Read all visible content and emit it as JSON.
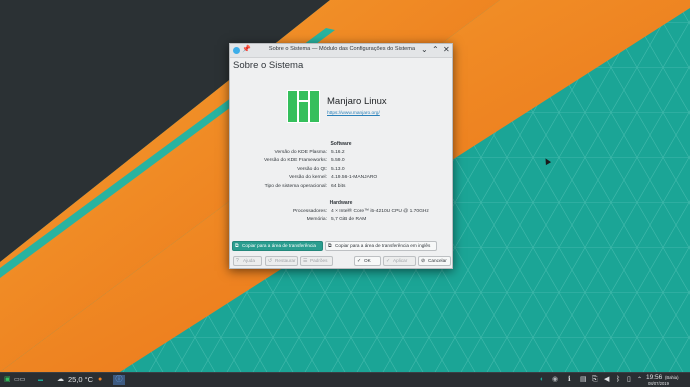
{
  "window": {
    "title": "Sobre o Sistema — Módulo das Configurações do Sistema",
    "heading": "Sobre o Sistema",
    "pin_icon": "pin-icon",
    "minimize_glyph": "⌄",
    "maximize_glyph": "⌃",
    "close_glyph": "✕"
  },
  "about": {
    "distro_name": "Manjaro Linux",
    "distro_url": "https://www.manjaro.org/",
    "software_heading": "Software",
    "software": [
      {
        "label": "Versão do KDE Plasma:",
        "value": "5.16.2"
      },
      {
        "label": "Versão do KDE Frameworks:",
        "value": "5.59.0"
      },
      {
        "label": "Versão do Qt:",
        "value": "5.13.0"
      },
      {
        "label": "Versão do kernel:",
        "value": "4.19.56-1-MANJARO"
      },
      {
        "label": "Tipo de sistema operacional:",
        "value": "64 bits"
      }
    ],
    "hardware_heading": "Hardware",
    "hardware": [
      {
        "label": "Processadores:",
        "value": "4 × Intel® Core™ i5-4210U CPU @ 1.70GHz"
      },
      {
        "label": "Memória:",
        "value": "5,7 GiB de RAM"
      }
    ]
  },
  "buttons": {
    "copy": "Copiar para a área de transferência",
    "copy_english": "Copiar para a área de transferência em inglês",
    "help": "Ajuda",
    "reset": "Restaurar",
    "defaults": "Padrões",
    "ok": "OK",
    "apply": "Aplicar",
    "cancel": "Cancelar"
  },
  "taskbar": {
    "temperature": "25,0 °C",
    "time": "19:56",
    "location": "(Bahia)",
    "date": "08/07/2019"
  },
  "colors": {
    "accent": "#2a9d8f",
    "teal_wallpaper": "#1fa89a",
    "orange_wallpaper": "#f08020",
    "manjaro_green": "#35bf5c"
  }
}
